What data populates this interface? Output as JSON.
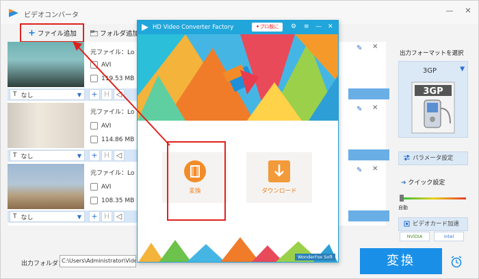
{
  "app": {
    "title": "ビデオコンバータ",
    "minimize": "—",
    "close": "✕"
  },
  "toolbar": {
    "add_file": "ファイル追加",
    "add_folder": "フォルダ追加"
  },
  "files": [
    {
      "name_label": "元ファイル：",
      "name": "Lo",
      "format": "AVI",
      "size": "119.53 MB",
      "subtitle": "なし"
    },
    {
      "name_label": "元ファイル：",
      "name": "Lo",
      "format": "AVI",
      "size": "114.86 MB",
      "subtitle": "なし"
    },
    {
      "name_label": "元ファイル：",
      "name": "Lo",
      "format": "AVI",
      "size": "108.35 MB",
      "subtitle": "なし"
    }
  ],
  "output": {
    "folder_label": "出力フォルダ：",
    "path": "C:\\Users\\Administrator\\Videos\\Wonde"
  },
  "convert_button": "変換",
  "side": {
    "title": "出力フォーマットを選択",
    "format": "3GP",
    "format_badge": "3GP",
    "params_button": "パラメータ設定",
    "quick_label": "クイック設定",
    "slider_label": "自動",
    "gpu_button": "ビデオカード加速",
    "gpu_chips": [
      "NVIDIA",
      "intel"
    ]
  },
  "hd": {
    "title": "HD Video Converter Factory",
    "pro_button": "プロ版に",
    "convert_tile": "変換",
    "download_tile": "ダウンロード",
    "footer_brand": "WonderFox Soft"
  },
  "colors": {
    "accent": "#1a8fe8",
    "highlight": "#e0201b",
    "tile_orange": "#f28c29"
  }
}
